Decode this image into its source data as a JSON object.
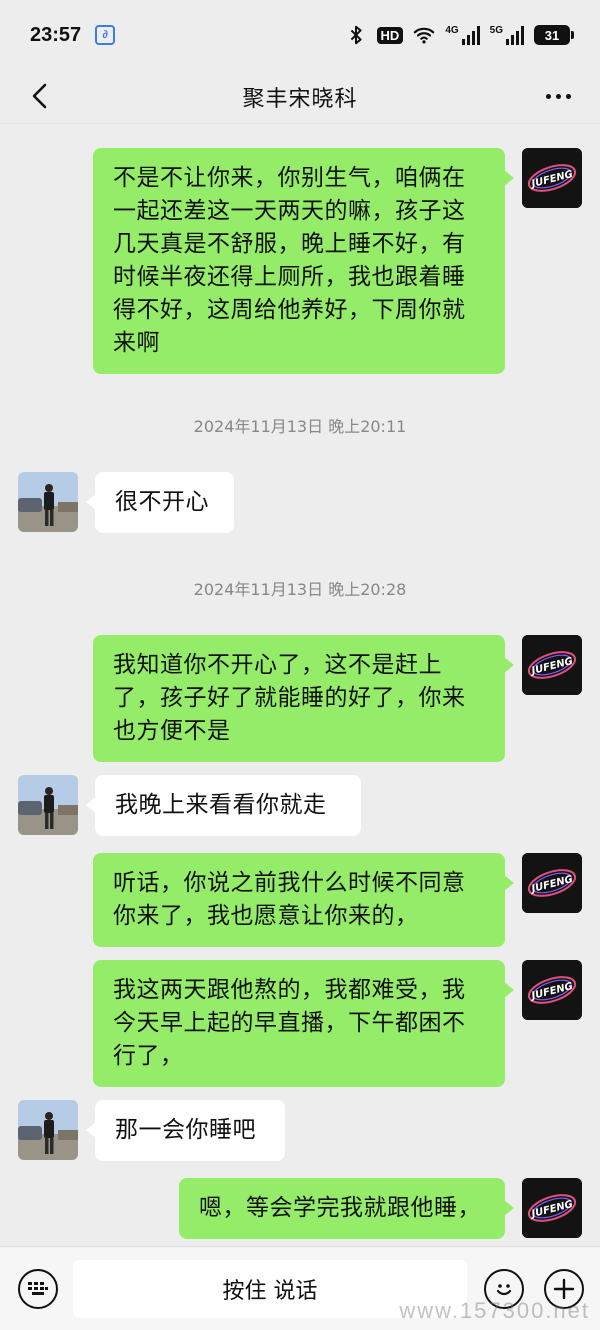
{
  "status_bar": {
    "time": "23:57",
    "app_badge": "∂",
    "hd_label": "HD",
    "net_4g": "4G",
    "net_5g": "5G",
    "battery": "31"
  },
  "header": {
    "title": "聚丰宋晓科"
  },
  "brand_logo_text": "JUFENG",
  "messages": [
    {
      "side": "me",
      "text": "不是不让你来，你别生气，咱俩在一起还差这一天两天的嘛，孩子这几天真是不舒服，晚上睡不好，有时候半夜还得上厕所，我也跟着睡得不好，这周给他养好，下周你就来啊"
    },
    {
      "type": "timestamp",
      "text": "2024年11月13日 晚上20:11"
    },
    {
      "side": "other",
      "text": "很不开心"
    },
    {
      "type": "timestamp",
      "text": "2024年11月13日 晚上20:28"
    },
    {
      "side": "me",
      "text": "我知道你不开心了，这不是赶上了，孩子好了就能睡的好了，你来也方便不是"
    },
    {
      "side": "other",
      "text": "我晚上来看看你就走"
    },
    {
      "side": "me",
      "text": "听话，你说之前我什么时候不同意你来了，我也愿意让你来的，"
    },
    {
      "side": "me",
      "text": "我这两天跟他熬的，我都难受，我今天早上起的早直播，下午都困不行了，"
    },
    {
      "side": "other",
      "text": "那一会你睡吧"
    },
    {
      "side": "me",
      "text": "嗯，等会学完我就跟他睡，"
    }
  ],
  "input_bar": {
    "voice_label": "按住 说话"
  },
  "watermark": "www.157300.net"
}
